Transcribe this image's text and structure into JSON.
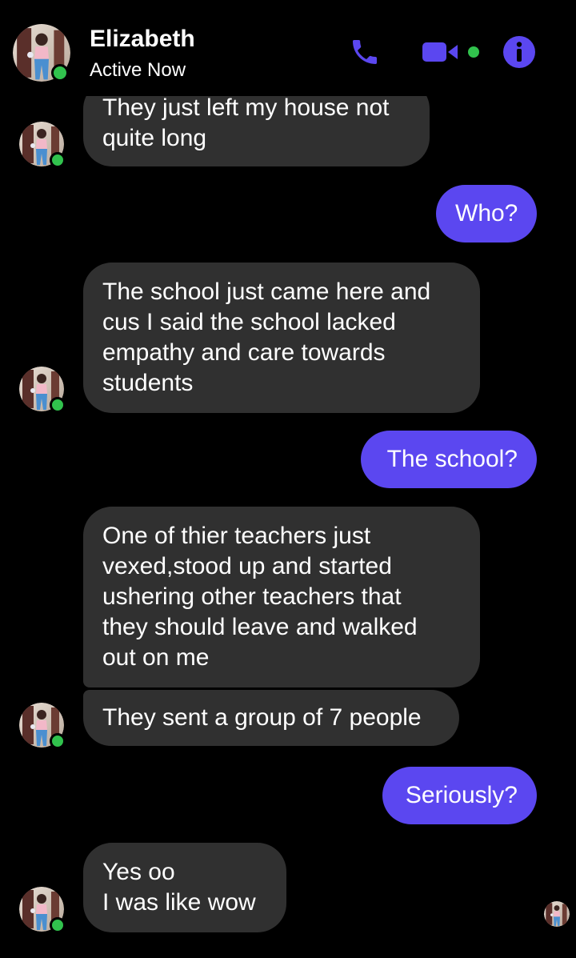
{
  "header": {
    "contact_name": "Elizabeth",
    "status": "Active Now",
    "call_icon": "phone-icon",
    "video_icon": "video-camera-icon",
    "info_icon": "info-icon"
  },
  "messages": [
    {
      "from": "contact",
      "lines": [
        "They just left my house not",
        "quite long"
      ]
    },
    {
      "from": "me",
      "lines": [
        "Who?"
      ]
    },
    {
      "from": "contact",
      "lines": [
        "The school just came here and",
        "cus I said the school lacked",
        "empathy and care towards",
        "students"
      ]
    },
    {
      "from": "me",
      "lines": [
        "The school?"
      ]
    },
    {
      "from": "contact",
      "lines": [
        "One of thier teachers just",
        "vexed,stood up and started",
        "ushering other teachers  that",
        "they should leave and walked",
        "out on me"
      ]
    },
    {
      "from": "contact",
      "lines": [
        "They sent a group of 7 people"
      ]
    },
    {
      "from": "me",
      "lines": [
        "Seriously?"
      ]
    },
    {
      "from": "contact",
      "lines": [
        "Yes oo",
        "I was like wow"
      ]
    }
  ],
  "colors": {
    "background": "#000000",
    "incoming_bubble": "#303030",
    "outgoing_bubble": "#5b47f0",
    "accent": "#5b47f0",
    "online_dot": "#31c24d"
  }
}
